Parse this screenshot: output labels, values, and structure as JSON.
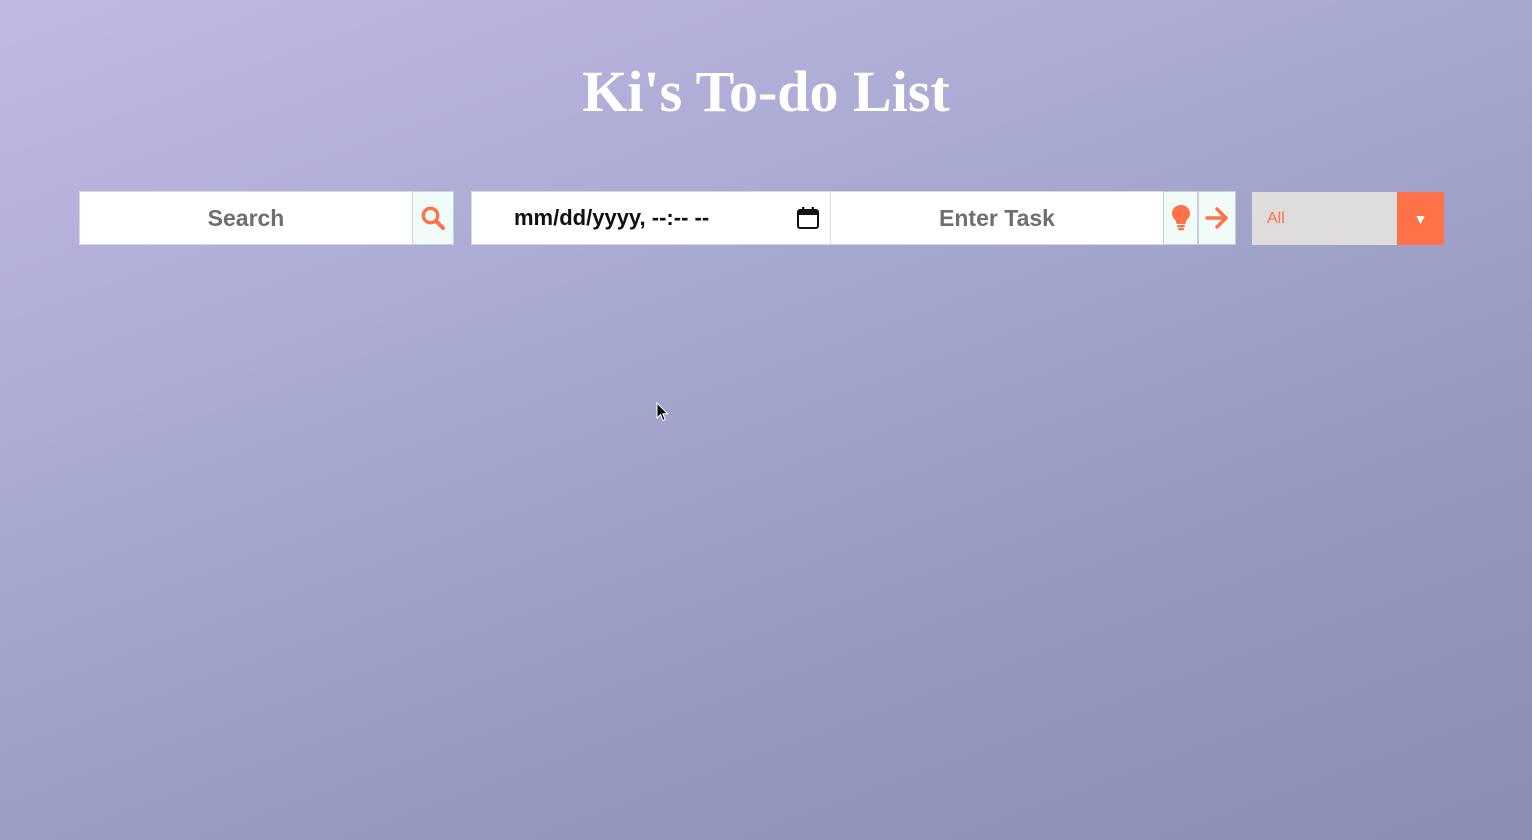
{
  "page_title": "Ki's To-do List",
  "search": {
    "placeholder": "Search",
    "button_icon": "search-icon"
  },
  "datetime": {
    "placeholder": "mm/dd/yyyy, --:-- --",
    "icon": "calendar-icon"
  },
  "task": {
    "placeholder": "Enter Task",
    "suggest_icon": "lightbulb-icon",
    "submit_icon": "arrow-right-icon"
  },
  "filter": {
    "selected": "All",
    "arrow": "▼"
  },
  "colors": {
    "accent": "#ff7148",
    "title": "#ffffff",
    "background_start": "#c1b9e3",
    "background_end": "#8a8db4",
    "select_bg": "#dedcdc"
  }
}
